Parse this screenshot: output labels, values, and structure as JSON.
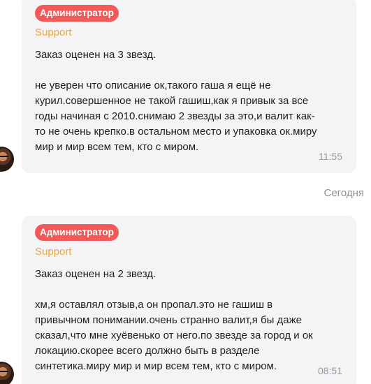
{
  "messages": [
    {
      "badge": "Администратор",
      "role": "Support",
      "text": "Заказ оценен на 3 звезд.\n\nне уверен что описание ок,такого гаша я ещё не\nкурил.совершенное не такой гашиш,как я привык за все\nгоды начиная с 2010.снимаю 2 звезды за это,и валит как-\nто не очень крепко.в остальном место и упаковка ок.миру\nмир и мир всем тем, кто с миром.",
      "time": "11:55"
    },
    {
      "badge": "Администратор",
      "role": "Support",
      "text": "Заказ оценен на 2 звезд.\n\nхм,я оставлял отзыв,а он пропал.это не гашиш в\nпривычном понимании.очень странно валит,я бы даже\nсказал,что мне хуёвенько от него.по звезде за город и ок\nлокацию.скорее всего должно быть в разделе\nсинтетика.миру мир и мир всем тем, кто с миром.",
      "time": "08:51"
    }
  ],
  "date_separator": "Сегодня",
  "colors": {
    "badge": "#f25a5a",
    "role": "#f0a640",
    "bubble": "#f4f4f6",
    "time": "#9a9a9e"
  }
}
